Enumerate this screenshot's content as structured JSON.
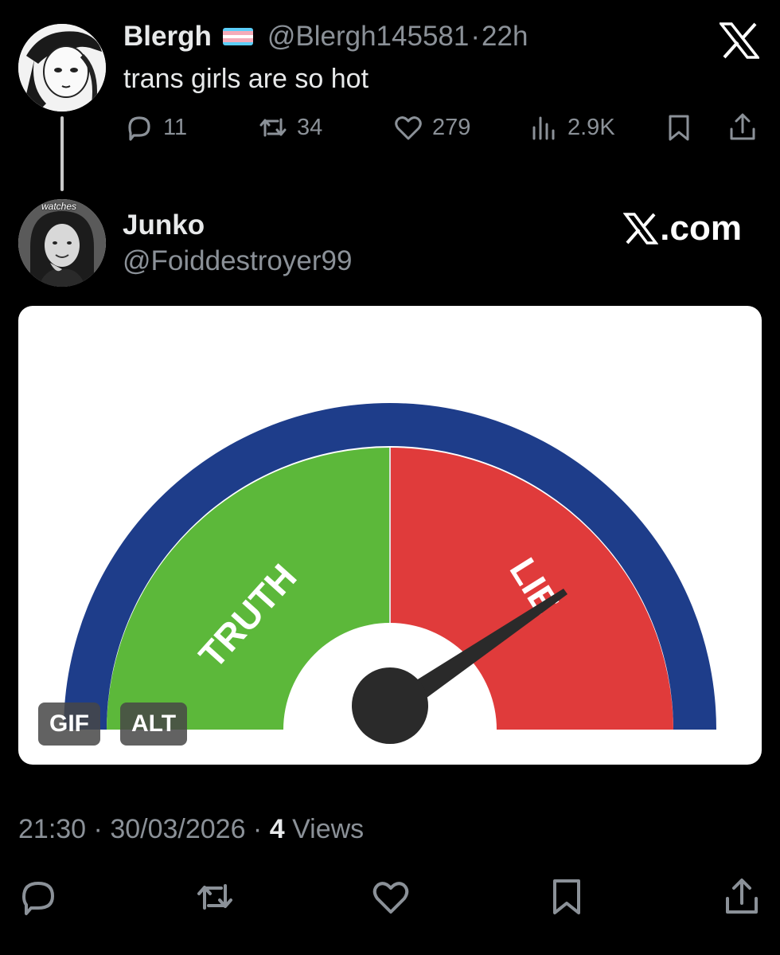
{
  "tweet": {
    "author_name": "Blergh",
    "handle": "@Blergh145581",
    "dot": "·",
    "time": "22h",
    "text": "trans girls are so hot",
    "reply_count": "11",
    "repost_count": "34",
    "like_count": "279",
    "view_count": "2.9K",
    "flag_colors": [
      "#5bcffa",
      "#f5abb9",
      "#ffffff",
      "#f5abb9",
      "#5bcffa"
    ]
  },
  "reply": {
    "author_name": "Junko",
    "handle": "@Foiddestroyer99",
    "avatar_label": "watches",
    "source": ".com"
  },
  "media": {
    "gauge_left_label": "TRUTH",
    "gauge_right_label": "LIE",
    "gif_badge": "GIF",
    "alt_badge": "ALT",
    "colors": {
      "green": "#5cb83a",
      "red": "#e03b3b",
      "ring": "#1e3d8a",
      "needle": "#2a2a2a"
    }
  },
  "meta": {
    "time": "21:30",
    "sep1": " · ",
    "date": "30/03/2026",
    "sep2": " · ",
    "views_count": "4",
    "views_label": " Views"
  },
  "icons": [
    "reply-icon",
    "repost-icon",
    "like-icon",
    "views-icon",
    "bookmark-icon",
    "share-icon",
    "x-logo-icon"
  ]
}
